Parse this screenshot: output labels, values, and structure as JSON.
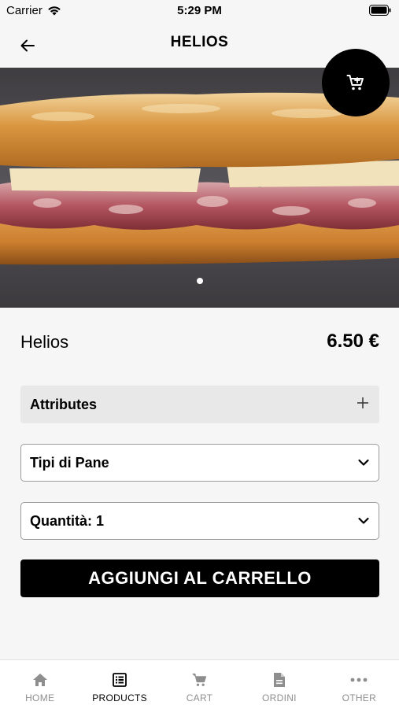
{
  "status": {
    "carrier": "Carrier",
    "time": "5:29 PM"
  },
  "nav": {
    "title": "HELIOS"
  },
  "product": {
    "name": "Helios",
    "price": "6.50 €"
  },
  "gallery": {
    "current_slide": 1,
    "total_slides": 1
  },
  "attributes": {
    "label": "Attributes"
  },
  "bread_select": {
    "label": "Tipi di Pane"
  },
  "quantity_select": {
    "label": "Quantità: 1"
  },
  "add_to_cart": {
    "label": "AGGIUNGI AL CARRELLO"
  },
  "tabs": [
    {
      "label": "HOME",
      "icon": "home-icon",
      "active": false
    },
    {
      "label": "PRODUCTS",
      "icon": "list-icon",
      "active": true
    },
    {
      "label": "CART",
      "icon": "cart-icon",
      "active": false
    },
    {
      "label": "ORDINI",
      "icon": "document-icon",
      "active": false
    },
    {
      "label": "OTHER",
      "icon": "more-icon",
      "active": false
    }
  ],
  "colors": {
    "accent": "#000000",
    "background": "#f6f6f6",
    "inactive_tab": "#8e8e8e"
  }
}
